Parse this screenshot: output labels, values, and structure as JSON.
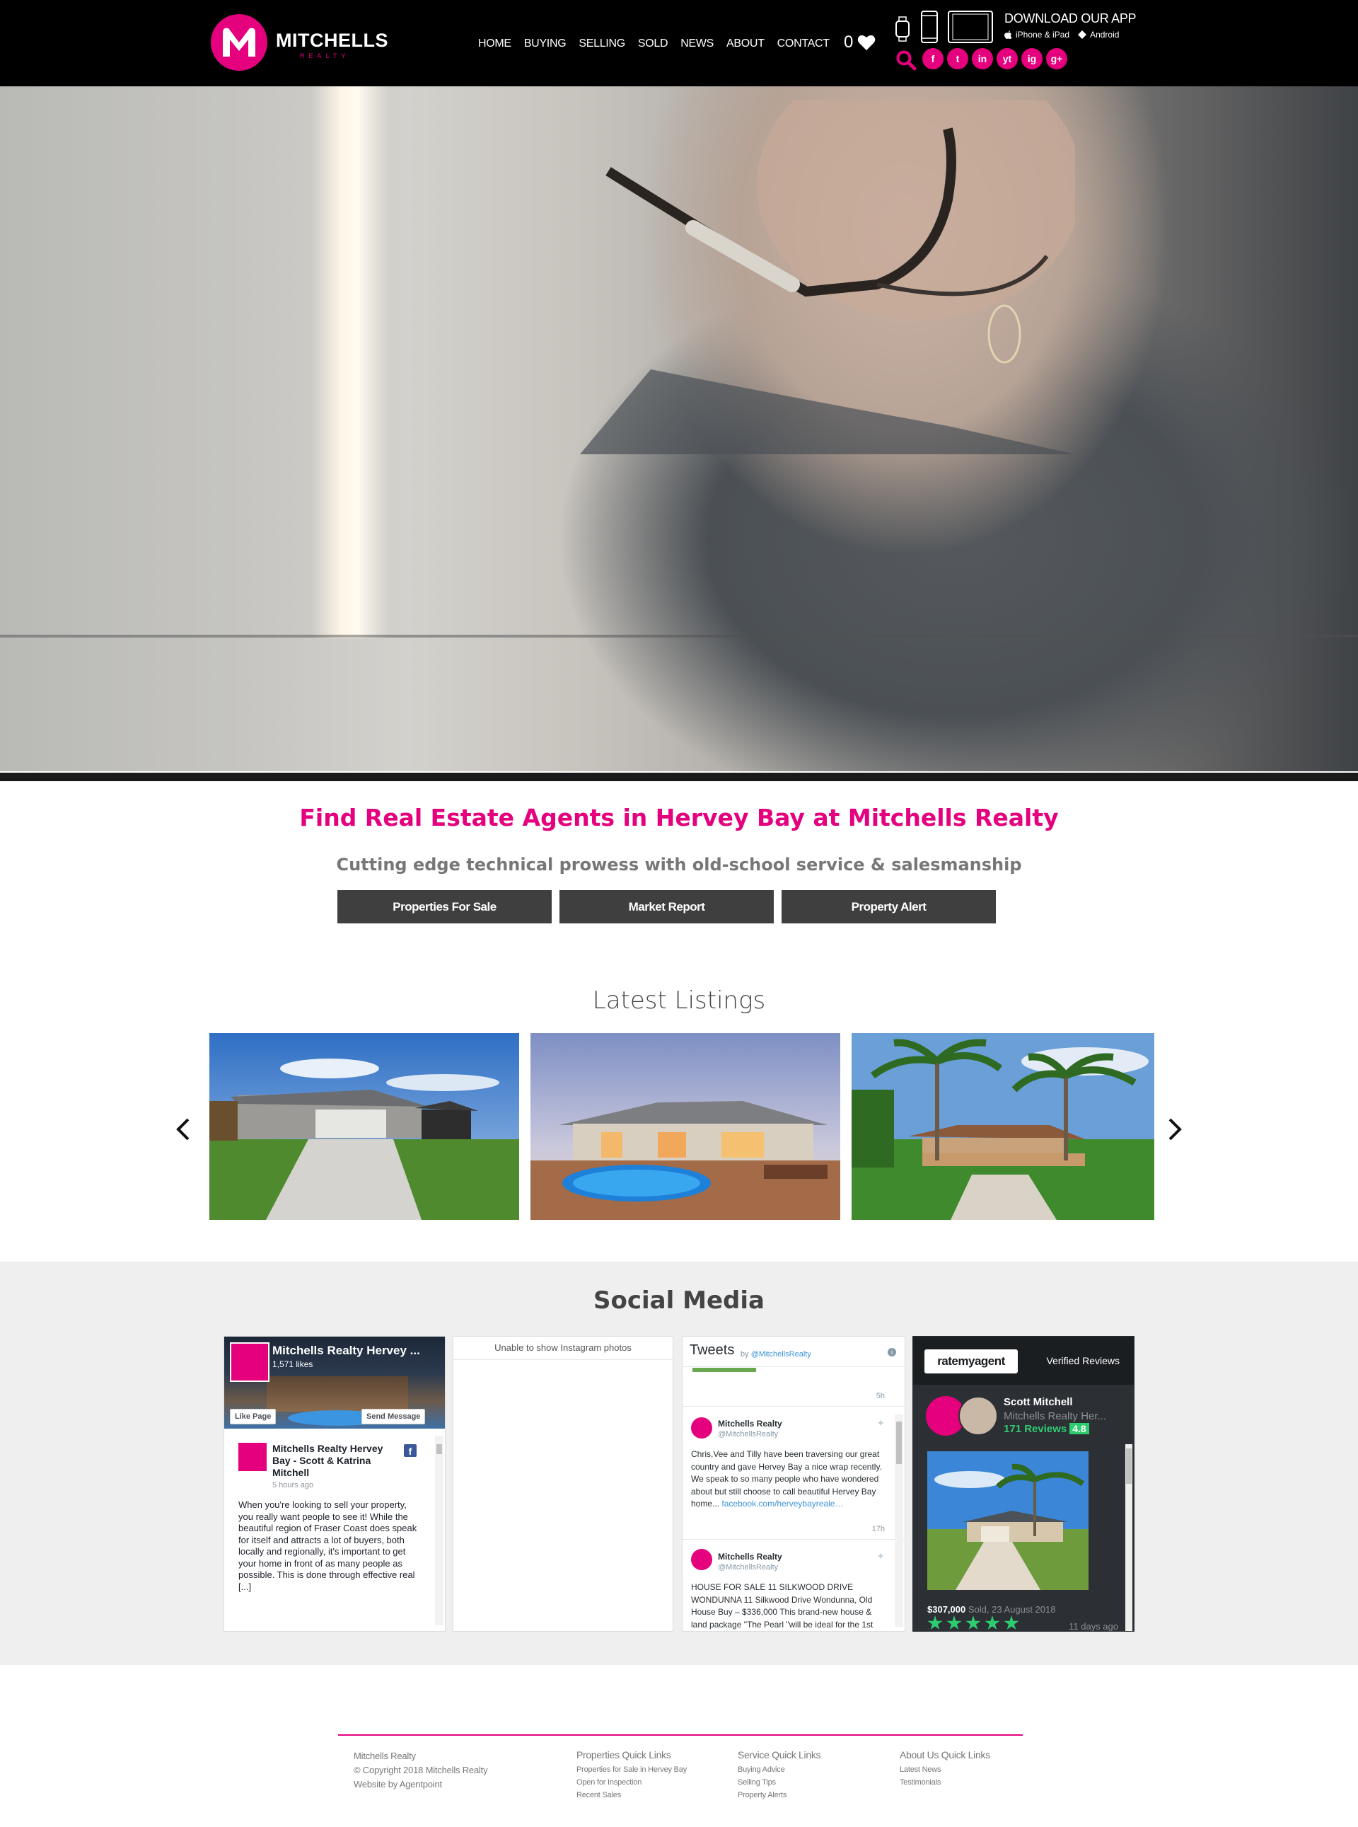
{
  "header": {
    "brand": "MITCHELLS",
    "brand_sub": "REALTY",
    "nav": [
      "HOME",
      "BUYING",
      "SELLING",
      "SOLD",
      "NEWS",
      "ABOUT",
      "CONTACT"
    ],
    "favourites_count": "0",
    "app_title": "DOWNLOAD OUR APP",
    "app_ios": "iPhone & iPad",
    "app_android": "Android",
    "socials": [
      "f",
      "t",
      "in",
      "yt",
      "ig",
      "g+"
    ],
    "accent": "#e5007e"
  },
  "intro": {
    "title": "Find Real Estate Agents in Hervey Bay at Mitchells Realty",
    "subtitle": "Cutting edge technical prowess with old-school service & salesmanship",
    "buttons": [
      "Properties For Sale",
      "Market Report",
      "Property Alert"
    ]
  },
  "listings": {
    "title": "Latest Listings"
  },
  "social": {
    "title": "Social Media",
    "facebook": {
      "page_name": "Mitchells Realty Hervey ...",
      "likes": "1,571 likes",
      "like_button": "Like Page",
      "message_button": "Send Message",
      "post_author": "Mitchells Realty Hervey Bay - Scott & Katrina Mitchell",
      "post_time": "5 hours ago",
      "post_text": "When you're looking to sell your property, you really want people to see it! While the beautiful region of Fraser Coast does speak for itself and attracts a lot of buyers, both locally and regionally, it's important to get your home in front of as many people as possible. This is done through effective real [...]"
    },
    "instagram": {
      "message": "Unable to show Instagram photos"
    },
    "twitter": {
      "title": "Tweets",
      "by": "by",
      "by_handle": "@MitchellsRealty",
      "first_time": "5h",
      "tweets": [
        {
          "name": "Mitchells Realty",
          "handle": "@MitchellsRealty",
          "text": "Chris,Vee and Tilly have been traversing our great country and gave Hervey Bay a nice wrap recently. We speak to so many people who have wondered about but still choose to call beautiful Hervey Bay home...",
          "link": "facebook.com/herveybayreale…",
          "time": "17h"
        },
        {
          "name": "Mitchells Realty",
          "handle": "@MitchellsRealty",
          "text": "HOUSE FOR SALE 11 SILKWOOD DRIVE WONDUNNA 11 Silkwood Drive Wondunna, Old House Buy – $336,000 This brand-new house & land package \"The Pearl \"will be ideal for the 1st"
        }
      ]
    },
    "ratemyagent": {
      "logo": "ratemyagent",
      "verified": "Verified Reviews",
      "agent_name": "Scott Mitchell",
      "agency": "Mitchells Realty Her...",
      "reviews": "171 Reviews",
      "score": "4.8",
      "price": "$307,000",
      "sold": "Sold, 23 August 2018",
      "ago": "11 days ago"
    }
  },
  "footer": {
    "col1": [
      "Mitchells Realty",
      "© Copyright 2018 Mitchells Realty",
      "Website by Agentpoint"
    ],
    "col2_head": "Properties Quick Links",
    "col2": [
      "Properties for Sale in Hervey Bay",
      "Open for Inspection",
      "Recent Sales"
    ],
    "col3_head": "Service Quick Links",
    "col3": [
      "Buying Advice",
      "Selling Tips",
      "Property Alerts"
    ],
    "col4_head": "About Us Quick Links",
    "col4": [
      "Latest News",
      "Testimonials"
    ]
  }
}
